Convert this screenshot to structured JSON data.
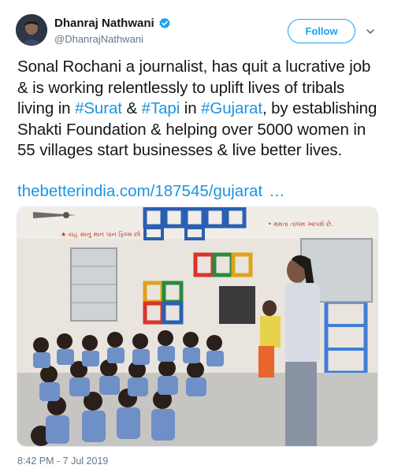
{
  "author": {
    "display_name": "Dhanraj Nathwani",
    "handle": "@DhanrajNathwani",
    "verified": true
  },
  "follow_label": "Follow",
  "tweet": {
    "seg1": "Sonal Rochani a journalist, has quit a lucrative job & is working relentlessly to uplift lives of tribals living in ",
    "hashtag1": "#Surat",
    "seg2": " & ",
    "hashtag2": "#Tapi",
    "seg3": " in ",
    "hashtag3": "#Gujarat",
    "seg4": ", by establishing Shakti Foundation & helping over 5000 women in 55 villages start businesses & live better lives.",
    "link": "thebetterindia.com/187545/gujarat",
    "link_ellipsis": "…"
  },
  "photo": {
    "wall_text_left": "★ યહ સાનુ માન પાન ફિલ્મ છો ★",
    "wall_text_right": "• મમતા તાલમ આપશે છે."
  },
  "timestamp": "8:42 PM - 7 Jul 2019",
  "colors": {
    "link": "#1b95e0",
    "follow_border": "#1da1f2",
    "meta": "#657786"
  },
  "icons": {
    "verified": "verified-badge-icon",
    "menu": "chevron-down-icon"
  }
}
